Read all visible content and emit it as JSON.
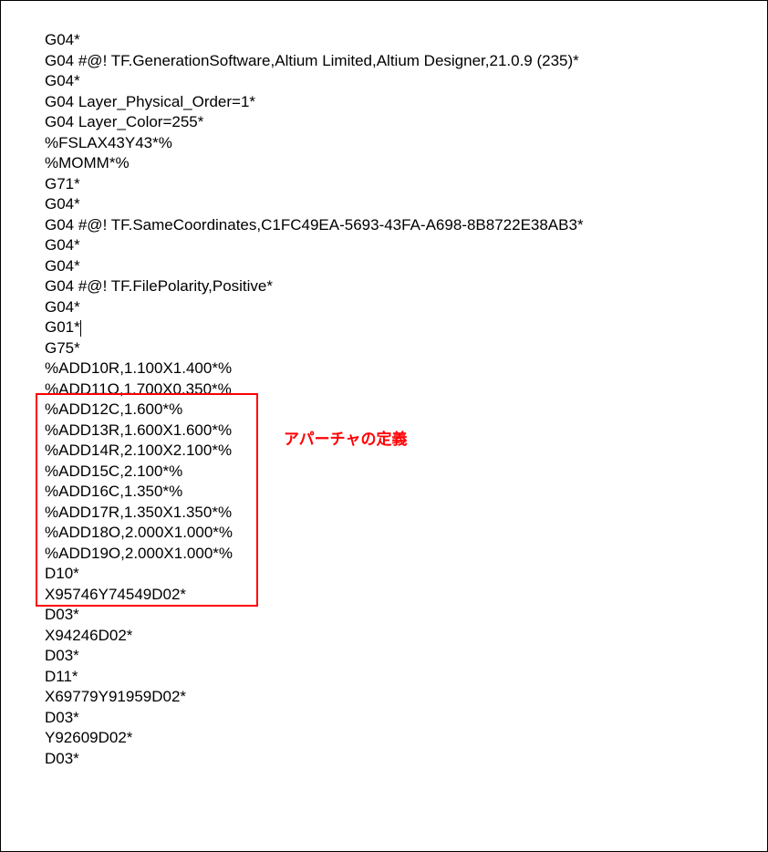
{
  "lines": [
    "G04*",
    "G04 #@! TF.GenerationSoftware,Altium Limited,Altium Designer,21.0.9 (235)*",
    "G04*",
    "G04 Layer_Physical_Order=1*",
    "G04 Layer_Color=255*",
    "%FSLAX43Y43*%",
    "%MOMM*%",
    "G71*",
    "G04*",
    "G04 #@! TF.SameCoordinates,C1FC49EA-5693-43FA-A698-8B8722E38AB3*",
    "G04*",
    "G04*",
    "G04 #@! TF.FilePolarity,Positive*",
    "G04*",
    "G01*",
    "G75*",
    "%ADD10R,1.100X1.400*%",
    "%ADD11O,1.700X0.350*%",
    "%ADD12C,1.600*%",
    "%ADD13R,1.600X1.600*%",
    "%ADD14R,2.100X2.100*%",
    "%ADD15C,2.100*%",
    "%ADD16C,1.350*%",
    "%ADD17R,1.350X1.350*%",
    "%ADD18O,2.000X1.000*%",
    "%ADD19O,2.000X1.000*%",
    "D10*",
    "X95746Y74549D02*",
    "D03*",
    "X94246D02*",
    "D03*",
    "D11*",
    "X69779Y91959D02*",
    "D03*",
    "Y92609D02*",
    "D03*"
  ],
  "annotation_text": "アパーチャの定義",
  "cursor_line_index": 14
}
